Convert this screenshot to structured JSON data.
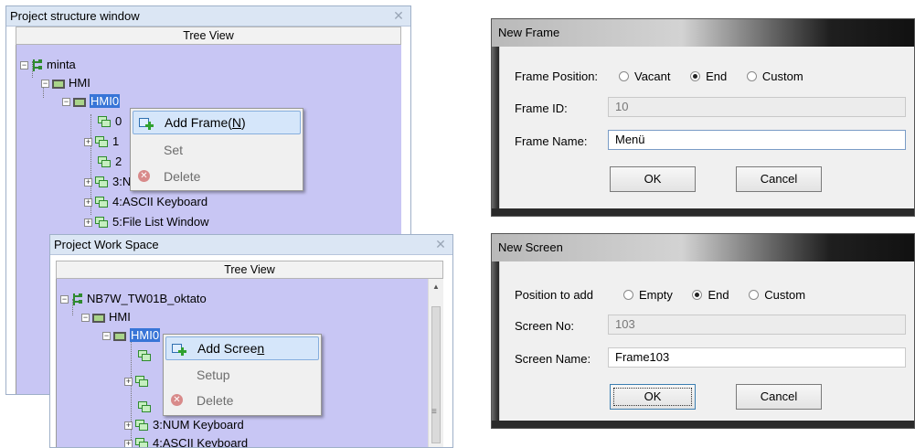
{
  "structure_window": {
    "title": "Project structure window",
    "tree_view_header": "Tree View",
    "tree": [
      {
        "label": "minta"
      },
      {
        "label": "HMI"
      },
      {
        "label": "HMI0"
      },
      {
        "label": "0"
      },
      {
        "label": "1"
      },
      {
        "label": "2"
      },
      {
        "label": "3:NUM Keyboard"
      },
      {
        "label": "4:ASCII Keyboard"
      },
      {
        "label": "5:File List Window"
      }
    ],
    "context_menu": {
      "add": "Add Frame(N)",
      "add_prefix": "Add Frame(",
      "add_key": "N",
      "add_suffix": ")",
      "set": "Set",
      "delete": "Delete"
    }
  },
  "work_space": {
    "title": "Project Work Space",
    "tree_view_header": "Tree View",
    "tree": [
      {
        "label": "NB7W_TW01B_oktato"
      },
      {
        "label": "HMI"
      },
      {
        "label": "HMI0"
      },
      {
        "label": "3:NUM Keyboard"
      },
      {
        "label": "4:ASCII Keyboard"
      }
    ],
    "context_menu": {
      "add": "Add Screen",
      "add_prefix": "Add Scree",
      "add_key": "n",
      "setup": "Setup",
      "delete": "Delete"
    }
  },
  "new_frame": {
    "title": "New Frame",
    "position_label": "Frame Position:",
    "options": [
      "Vacant",
      "End",
      "Custom"
    ],
    "selected": "End",
    "id_label": "Frame ID:",
    "id_value": "10",
    "name_label": "Frame Name:",
    "name_value": "Menü",
    "ok": "OK",
    "cancel": "Cancel"
  },
  "new_screen": {
    "title": "New Screen",
    "position_label": "Position to add",
    "options": [
      "Empty",
      "End",
      "Custom"
    ],
    "selected": "End",
    "no_label": "Screen No:",
    "no_value": "103",
    "name_label": "Screen Name:",
    "name_value": "Frame103",
    "ok": "OK",
    "cancel": "Cancel"
  },
  "colors": {
    "tree_bg": "#c8c6f4",
    "selection": "#3875d7",
    "menu_highlight": "#d5e6fa"
  }
}
